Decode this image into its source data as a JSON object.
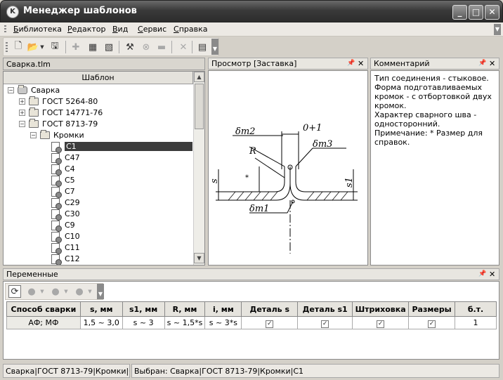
{
  "window": {
    "title": "Менеджер шаблонов",
    "minimize": "_",
    "maximize": "□",
    "close": "✕"
  },
  "menu": [
    {
      "label": "Библиотека",
      "u": "Б",
      "rest": "иблиотека"
    },
    {
      "label": "Редактор",
      "u": "Р",
      "rest": "едактор"
    },
    {
      "label": "Вид",
      "u": "В",
      "rest": "ид"
    },
    {
      "label": "Сервис",
      "u": "С",
      "rest": "ервис"
    },
    {
      "label": "Справка",
      "u": "С",
      "rest": "правка"
    }
  ],
  "left_panel": {
    "file": "Сварка.tlm",
    "column": "Шаблон",
    "tree": [
      {
        "label": "Сварка",
        "level": 0,
        "exp": "−",
        "kind": "root"
      },
      {
        "label": "ГОСТ 5264-80",
        "level": 1,
        "exp": "+",
        "kind": "folder"
      },
      {
        "label": "ГОСТ 14771-76",
        "level": 1,
        "exp": "+",
        "kind": "folder"
      },
      {
        "label": "ГОСТ 8713-79",
        "level": 1,
        "exp": "−",
        "kind": "folder"
      },
      {
        "label": "Кромки",
        "level": 2,
        "exp": "−",
        "kind": "folder"
      },
      {
        "label": "С1",
        "level": 3,
        "kind": "doc",
        "selected": true
      },
      {
        "label": "С47",
        "level": 3,
        "kind": "doc"
      },
      {
        "label": "С4",
        "level": 3,
        "kind": "doc"
      },
      {
        "label": "С5",
        "level": 3,
        "kind": "doc"
      },
      {
        "label": "С7",
        "level": 3,
        "kind": "doc"
      },
      {
        "label": "С29",
        "level": 3,
        "kind": "doc"
      },
      {
        "label": "С30",
        "level": 3,
        "kind": "doc"
      },
      {
        "label": "С9",
        "level": 3,
        "kind": "doc"
      },
      {
        "label": "С10",
        "level": 3,
        "kind": "doc"
      },
      {
        "label": "С11",
        "level": 3,
        "kind": "doc"
      },
      {
        "label": "С12",
        "level": 3,
        "kind": "doc"
      }
    ]
  },
  "preview": {
    "title": "Просмотр [Заставка]",
    "labels": {
      "dm2": "δm2",
      "angle": "0+1",
      "r": "R",
      "dm3": "δm3",
      "s": "s",
      "star": "*",
      "s1": "s1",
      "dm1": "δm1"
    }
  },
  "comment": {
    "title": "Комментарий",
    "lines": [
      "Тип соединения - стыковое.",
      "Форма подготавливаемых",
      "кромок - с отбортовкой двух",
      "кромок.",
      "Характер сварного шва -",
      "односторонний.",
      "Примечание: * Размер для",
      "справок."
    ]
  },
  "variables": {
    "title": "Переменные",
    "headers": [
      "Способ сварки",
      "s, мм",
      "s1, мм",
      "R, мм",
      "i, мм",
      "Деталь s",
      "Деталь s1",
      "Штриховка",
      "Размеры",
      "б.т."
    ],
    "row": [
      "АФ; МФ",
      "1,5 ~ 3,0",
      "s ~ 3",
      "s ~ 1,5*s",
      "s ~ 3*s",
      "✓",
      "✓",
      "✓",
      "✓",
      "1"
    ]
  },
  "status": {
    "left": "Сварка|ГОСТ 8713-79|Кромки|С1",
    "right": "Выбран: Сварка|ГОСТ 8713-79|Кромки|С1"
  }
}
